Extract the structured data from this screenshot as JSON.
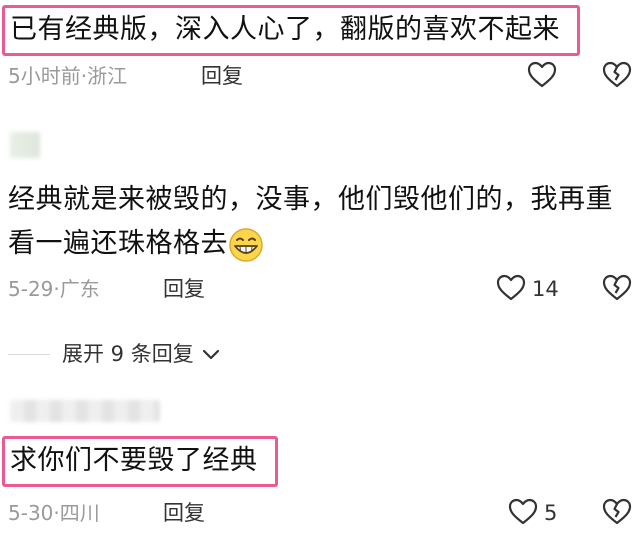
{
  "comments": [
    {
      "text": "已有经典版，深入人心了，翻版的喜欢不起来",
      "time": "5小时前",
      "location": "浙江",
      "reply_label": "回复",
      "like_count": ""
    },
    {
      "text_line1": "经典就是来被毁的，没事，他们毁他们的，我再重",
      "text_line2": "看一遍还珠格格去",
      "time": "5-29",
      "location": "广东",
      "reply_label": "回复",
      "like_count": "14"
    },
    {
      "text": "求你们不要毁了经典",
      "time": "5-30",
      "location": "四川",
      "reply_label": "回复",
      "like_count": "5"
    }
  ],
  "expand_replies": {
    "label": "展开 9 条回复"
  },
  "separator": "·",
  "colors": {
    "highlight": "#ec5a93",
    "meta_gray": "#9a9a9a",
    "icon_gray": "#333333"
  },
  "icons": {
    "like": "heart-outline-icon",
    "dislike": "broken-heart-icon",
    "emoji": "grinning-face-emoji",
    "expand": "chevron-down-icon"
  }
}
